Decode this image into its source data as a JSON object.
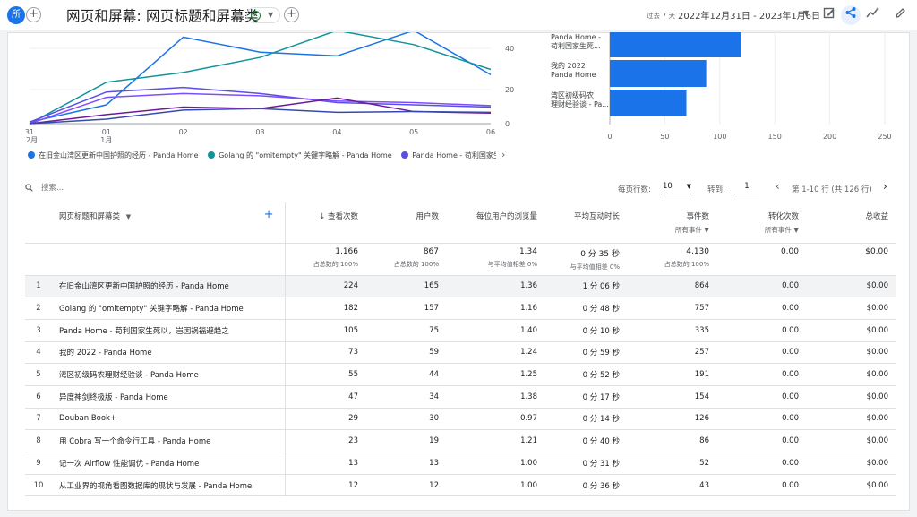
{
  "header": {
    "avatar_text": "所",
    "title": "网页和屏幕: 网页标题和屏幕类",
    "range_label": "过去 7 天",
    "range_value": "2022年12月31日 - 2023年1月6日"
  },
  "chart_data": [
    {
      "type": "line",
      "x": [
        "31 12月",
        "01 1月",
        "02",
        "03",
        "04",
        "05",
        "06"
      ],
      "y_ticks": [
        "0",
        "20",
        "40"
      ],
      "series": [
        {
          "name": "在旧金山湾区更新中国护照的经历 - Panda Home",
          "color": "#1a73e8"
        },
        {
          "name": "Golang 的 \"omitempty\" 关键字略解 - Panda Home",
          "color": "#12939a"
        },
        {
          "name": "Panda Home - 苟利国家生死以",
          "color": "#5b4ee1"
        }
      ]
    },
    {
      "type": "bar",
      "orientation": "horizontal",
      "categories": [
        "Panda Home - 苟利国家生死...",
        "我的 2022 - Panda Home",
        "湾区初级码农理财经验谈 - Pa..."
      ],
      "values": [
        105,
        73,
        55
      ],
      "xlim": [
        0,
        250
      ],
      "x_ticks": [
        "0",
        "50",
        "100",
        "150",
        "200",
        "250"
      ]
    }
  ],
  "controls": {
    "search_placeholder": "搜索...",
    "rows_label": "每页行数:",
    "rows_value": "10",
    "goto_label": "转到:",
    "goto_value": "1",
    "pagination": "第 1-10 行 (共 126 行)"
  },
  "table": {
    "dimension_header": "网页标题和屏幕类",
    "columns": [
      "↓ 查看次数",
      "用户数",
      "每位用户的浏览量",
      "平均互动时长",
      "事件数",
      "转化次数",
      "总收益"
    ],
    "event_filter_1": "所有事件",
    "event_filter_2": "所有事件",
    "totals": [
      "1,166",
      "867",
      "1.34",
      "0 分 35 秒",
      "4,130",
      "0.00",
      "$0.00"
    ],
    "totals_sub": [
      "占总数的 100%",
      "占总数的 100%",
      "与平均值相差 0%",
      "与平均值相差 0%",
      "占总数的 100%",
      "",
      ""
    ],
    "rows": [
      [
        "1",
        "在旧金山湾区更新中国护照的经历 - Panda Home",
        "224",
        "165",
        "1.36",
        "1 分 06 秒",
        "864",
        "0.00",
        "$0.00"
      ],
      [
        "2",
        "Golang 的 \"omitempty\" 关键字略解 - Panda Home",
        "182",
        "157",
        "1.16",
        "0 分 48 秒",
        "757",
        "0.00",
        "$0.00"
      ],
      [
        "3",
        "Panda Home - 苟利国家生死以，岂因祸福避趋之",
        "105",
        "75",
        "1.40",
        "0 分 10 秒",
        "335",
        "0.00",
        "$0.00"
      ],
      [
        "4",
        "我的 2022 - Panda Home",
        "73",
        "59",
        "1.24",
        "0 分 59 秒",
        "257",
        "0.00",
        "$0.00"
      ],
      [
        "5",
        "湾区初级码农理财经验谈 - Panda Home",
        "55",
        "44",
        "1.25",
        "0 分 52 秒",
        "191",
        "0.00",
        "$0.00"
      ],
      [
        "6",
        "异度神剑终极版 - Panda Home",
        "47",
        "34",
        "1.38",
        "0 分 17 秒",
        "154",
        "0.00",
        "$0.00"
      ],
      [
        "7",
        "Douban Book+",
        "29",
        "30",
        "0.97",
        "0 分 14 秒",
        "126",
        "0.00",
        "$0.00"
      ],
      [
        "8",
        "用 Cobra 写一个命令行工具 - Panda Home",
        "23",
        "19",
        "1.21",
        "0 分 40 秒",
        "86",
        "0.00",
        "$0.00"
      ],
      [
        "9",
        "记一次 Airflow 性能调优 - Panda Home",
        "13",
        "13",
        "1.00",
        "0 分 31 秒",
        "52",
        "0.00",
        "$0.00"
      ],
      [
        "10",
        "从工业界的视角看图数据库的现状与发展 - Panda Home",
        "12",
        "12",
        "1.00",
        "0 分 36 秒",
        "43",
        "0.00",
        "$0.00"
      ]
    ]
  }
}
